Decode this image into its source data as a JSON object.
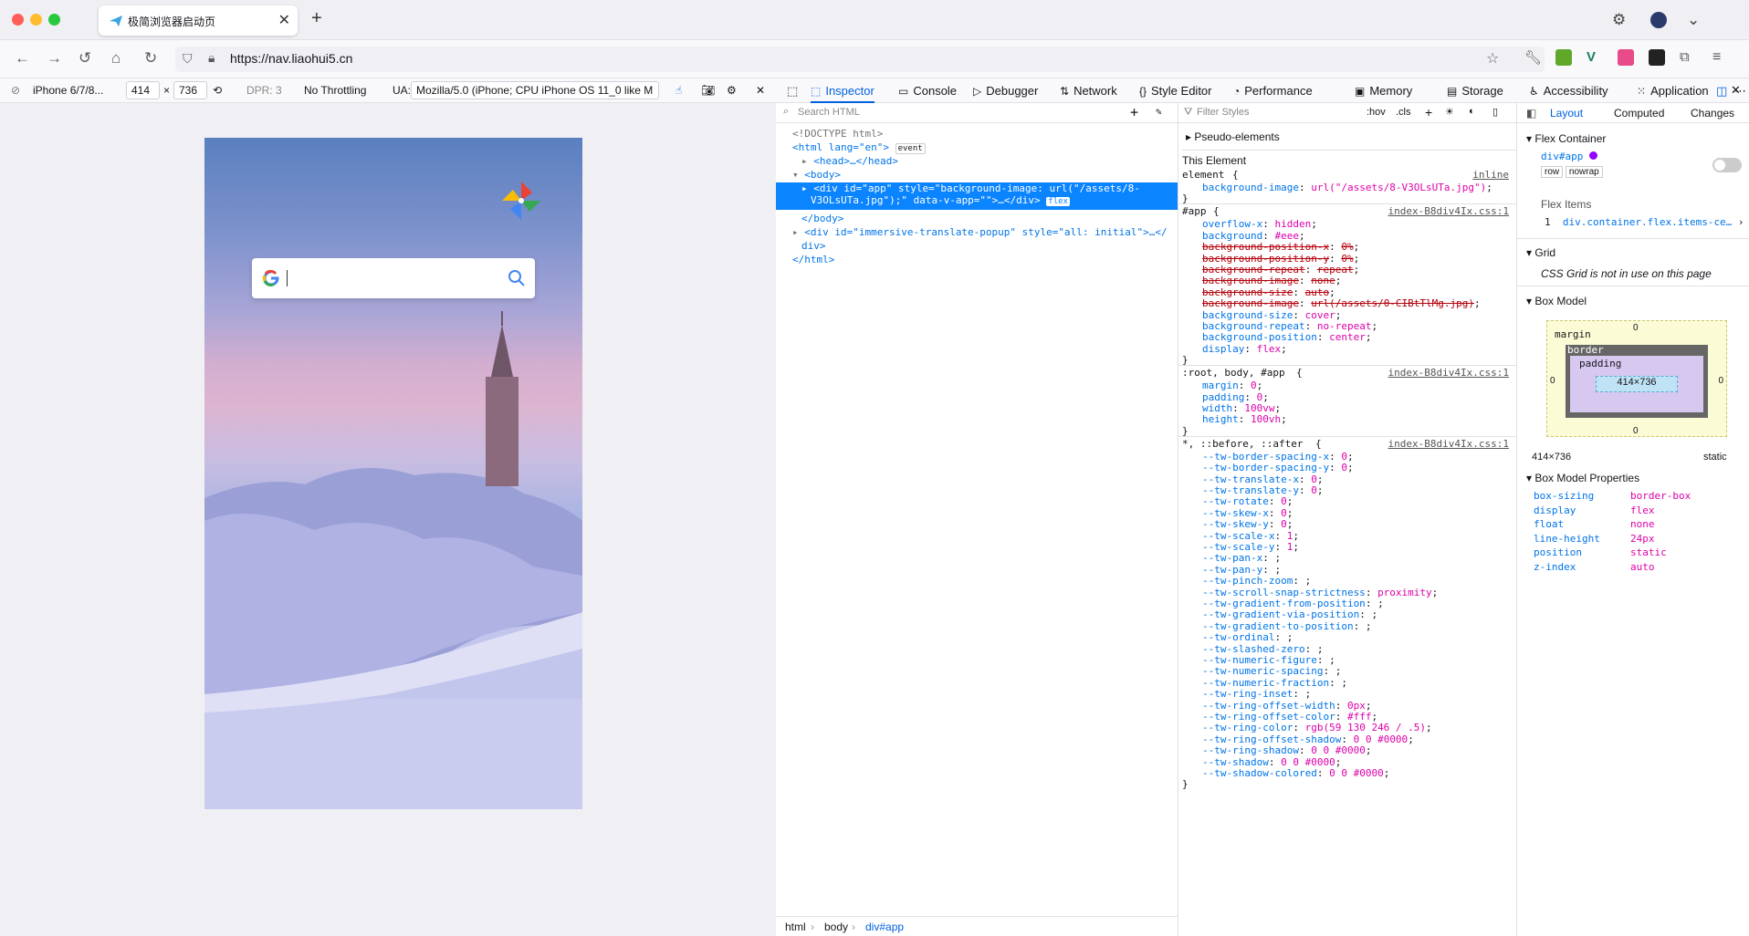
{
  "window": {
    "tab_title": "极简浏览器启动页",
    "url": "https://nav.liaohui5.cn"
  },
  "rdm": {
    "device": "iPhone 6/7/8...",
    "width": "414",
    "times": "×",
    "height": "736",
    "dpr": "DPR: 3",
    "throttle": "No Throttling",
    "ua_label": "UA:",
    "ua_value": "Mozilla/5.0 (iPhone; CPU iPhone OS 11_0 like M"
  },
  "devtools": {
    "tabs": [
      "Inspector",
      "Console",
      "Debugger",
      "Network",
      "Style Editor",
      "Performance",
      "Memory",
      "Storage",
      "Accessibility",
      "Application"
    ]
  },
  "markup": {
    "search_placeholder": "Search HTML",
    "lines": [
      {
        "t": "<!DOCTYPE html>"
      },
      {
        "t": "<html lang=\"en\">",
        "badge": "event"
      },
      {
        "t": "<head>…</head>"
      },
      {
        "t": "<body>"
      },
      {
        "t": "<div id=\"app\" style=\"background-image: url(\"/assets/8-"
      },
      {
        "t": "V3OLsUTa.jpg\");\" data-v-app=\"\">…</div>",
        "badge": "flex"
      },
      {
        "t": "</body>"
      },
      {
        "t": "<div id=\"immersive-translate-popup\" style=\"all: initial\">…</"
      },
      {
        "t": "div>"
      },
      {
        "t": "</html>"
      }
    ],
    "breadcrumb": [
      "html",
      "body",
      "div#app"
    ]
  },
  "rules": {
    "filter_placeholder": "Filter Styles",
    "hov": ":hov",
    "cls": ".cls",
    "pseudo": "Pseudo-elements",
    "this_element": "This Element",
    "blocks": [
      {
        "selector": "element",
        "source": "inline",
        "props": [
          [
            "background-image",
            "url(\"/assets/8-V3OLsUTa.jpg\")"
          ]
        ]
      },
      {
        "selector": "#app",
        "source": "index-B8div4Ix.css:1",
        "props": [
          [
            "overflow-x",
            "hidden"
          ],
          [
            "background",
            "#eee"
          ],
          [
            "background-position-x",
            "0%",
            "s"
          ],
          [
            "background-position-y",
            "0%",
            "s"
          ],
          [
            "background-repeat",
            "repeat",
            "s"
          ],
          [
            "background-image",
            "none",
            "s"
          ],
          [
            "background-size",
            "auto",
            "s"
          ],
          [
            "background-image",
            "url(/assets/0-CIBtTlMg.jpg)",
            "s"
          ],
          [
            "background-size",
            "cover"
          ],
          [
            "background-repeat",
            "no-repeat"
          ],
          [
            "background-position",
            "center"
          ],
          [
            "display",
            "flex"
          ]
        ]
      },
      {
        "selector": ":root, body, #app",
        "source": "index-B8div4Ix.css:1",
        "props": [
          [
            "margin",
            "0"
          ],
          [
            "padding",
            "0"
          ],
          [
            "width",
            "100vw"
          ],
          [
            "height",
            "100vh"
          ]
        ]
      },
      {
        "selector": "*, ::before, ::after",
        "source": "index-B8div4Ix.css:1",
        "props": [
          [
            "--tw-border-spacing-x",
            "0"
          ],
          [
            "--tw-border-spacing-y",
            "0"
          ],
          [
            "--tw-translate-x",
            "0"
          ],
          [
            "--tw-translate-y",
            "0"
          ],
          [
            "--tw-rotate",
            "0"
          ],
          [
            "--tw-skew-x",
            "0"
          ],
          [
            "--tw-skew-y",
            "0"
          ],
          [
            "--tw-scale-x",
            "1"
          ],
          [
            "--tw-scale-y",
            "1"
          ],
          [
            "--tw-pan-x",
            ""
          ],
          [
            "--tw-pan-y",
            ""
          ],
          [
            "--tw-pinch-zoom",
            ""
          ],
          [
            "--tw-scroll-snap-strictness",
            "proximity"
          ],
          [
            "--tw-gradient-from-position",
            ""
          ],
          [
            "--tw-gradient-via-position",
            ""
          ],
          [
            "--tw-gradient-to-position",
            ""
          ],
          [
            "--tw-ordinal",
            ""
          ],
          [
            "--tw-slashed-zero",
            ""
          ],
          [
            "--tw-numeric-figure",
            ""
          ],
          [
            "--tw-numeric-spacing",
            ""
          ],
          [
            "--tw-numeric-fraction",
            ""
          ],
          [
            "--tw-ring-inset",
            ""
          ],
          [
            "--tw-ring-offset-width",
            "0px"
          ],
          [
            "--tw-ring-offset-color",
            "#fff"
          ],
          [
            "--tw-ring-color",
            "rgb(59 130 246 / .5)"
          ],
          [
            "--tw-ring-offset-shadow",
            "0 0 #0000"
          ],
          [
            "--tw-ring-shadow",
            "0 0 #0000"
          ],
          [
            "--tw-shadow",
            "0 0 #0000"
          ],
          [
            "--tw-shadow-colored",
            "0 0 #0000"
          ]
        ]
      }
    ]
  },
  "layout": {
    "tabs": [
      "Layout",
      "Computed",
      "Changes"
    ],
    "flex_container": "Flex Container",
    "element": "div#app",
    "row": "row",
    "nowrap": "nowrap",
    "flex_items": "Flex Items",
    "flex_item_index": "1",
    "flex_item": "div.container.flex.items-ce…",
    "grid": "Grid",
    "grid_msg": "CSS Grid is not in use on this page",
    "box_model": "Box Model",
    "margin": "margin",
    "border": "border",
    "padding": "padding",
    "content_size": "414×736",
    "zero": "0",
    "size": "414×736",
    "position": "static",
    "bmp_title": "Box Model Properties",
    "bmp": [
      [
        "box-sizing",
        "border-box"
      ],
      [
        "display",
        "flex"
      ],
      [
        "float",
        "none"
      ],
      [
        "line-height",
        "24px"
      ],
      [
        "position",
        "static"
      ],
      [
        "z-index",
        "auto"
      ]
    ]
  },
  "colors": {
    "accent": "#0060df",
    "selected_row": "#0a84ff"
  }
}
